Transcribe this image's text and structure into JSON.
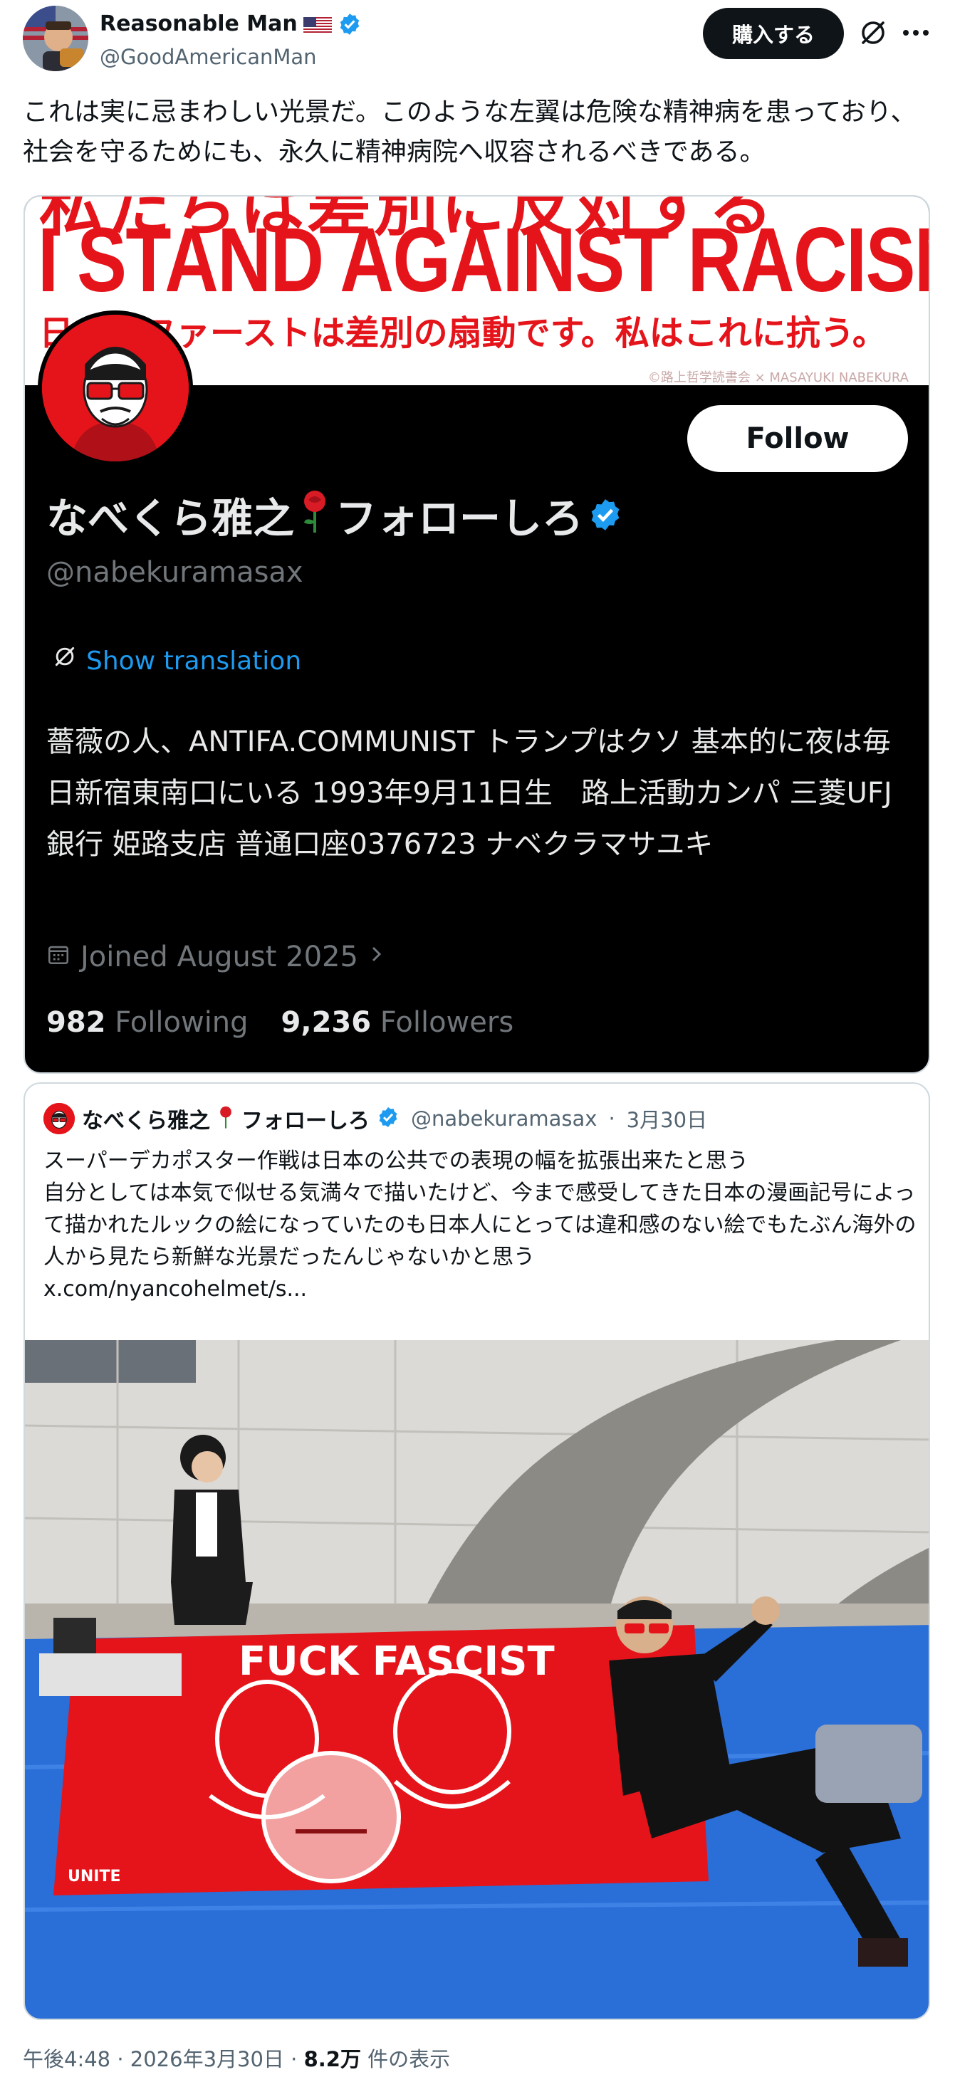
{
  "author": {
    "name": "Reasonable Man",
    "handle": "@GoodAmericanMan",
    "flag_icon": "us-flag",
    "verified_icon": "verified-badge-icon"
  },
  "actions": {
    "buy_label": "購入する",
    "grok_icon": "grok-icon",
    "more_icon": "more-icon"
  },
  "tweet": {
    "text": "これは実に忌まわしい光景だ。このような左翼は危険な精神病を患っており、社会を守るためにも、永久に精神病院へ収容されるべきである。"
  },
  "profile_card": {
    "banner_top_text": "私たちは差別に反対する",
    "banner_main_text": "I STAND AGAINST RACISM",
    "banner_sub_text": "日本人ファーストは差別の扇動です。私はこれに抗う。",
    "banner_credit": "©路上哲学読書会 × MASAYUKI NABEKURA",
    "follow_label": "Follow",
    "name": "なべくら雅之",
    "name_suffix": "フォローしろ",
    "rose_icon": "rose-icon",
    "handle": "@nabekuramasax",
    "translate_label": "Show translation",
    "bio": "薔薇の人、ANTIFA.COMMUNIST トランプはクソ 基本的に夜は毎日新宿東南口にいる 1993年9月11日生　路上活動カンパ 三菱UFJ銀行 姫路支店 普通口座0376723 ナベクラマサユキ",
    "joined": "Joined August 2025",
    "following_count": "982",
    "following_label": "Following",
    "followers_count": "9,236",
    "followers_label": "Followers"
  },
  "quote": {
    "name": "なべくら雅之",
    "name_suffix": "フォローしろ",
    "handle": "@nabekuramasax",
    "date": "3月30日",
    "text": "スーパーデカポスター作戦は日本の公共での表現の幅を拡張出来たと思う\n自分としては本気で似せる気満々で描いたけど、今まで感受してきた日本の漫画記号によって描かれたルックの絵になっていたのも日本人にとっては違和感のない絵でもたぶん海外の人から見たら新鮮な光景だったんじゃないかと思う\nx.com/nyancohelmet/s...",
    "poster_text": "FUCK FASCIST",
    "poster_bottom_text": "UNITE"
  },
  "meta": {
    "time": "午後4:48 · 2026年3月30日 · ",
    "views": "8.2万",
    "views_label": " 件の表示"
  },
  "colors": {
    "accent": "#1d9bf0",
    "poster_red": "#e5141b",
    "tarp_blue": "#2a6ed8"
  }
}
